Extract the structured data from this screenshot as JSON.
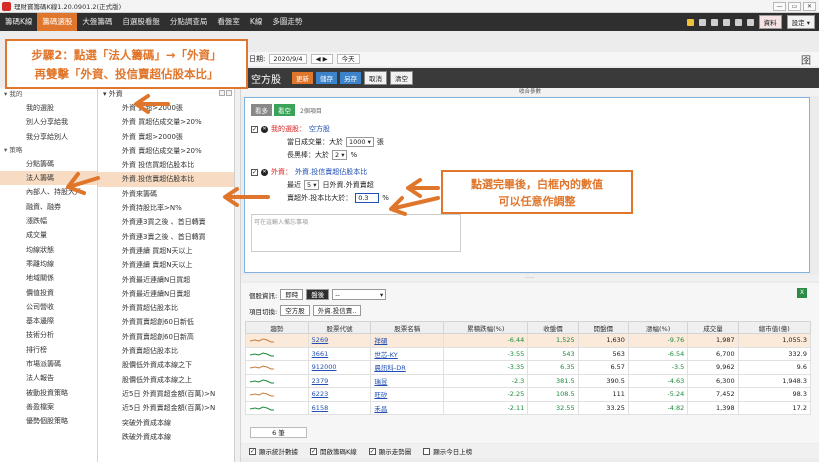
{
  "window": {
    "title": "理財寶籌碼K線1.20.0901.2(正式版)",
    "controls": [
      "—",
      "▭",
      "✕"
    ]
  },
  "menu": {
    "items": [
      "籌碼K線",
      "籌碼選股",
      "大盤籌碼",
      "自選股看盤",
      "分點調查局",
      "看盤室",
      "K線",
      "多圖走勢"
    ],
    "active_index": 1,
    "right_buttons": [
      "資料",
      "設定 ▾"
    ]
  },
  "date_bar": {
    "label": "日期:",
    "date": "2020/9/4",
    "nav": "◀ ▶",
    "today": "今天",
    "corner_icon": "囹"
  },
  "strategy_bar": {
    "name": "空方股",
    "buttons": [
      {
        "label": "更新",
        "style": "orange"
      },
      {
        "label": "儲存",
        "style": "blue"
      },
      {
        "label": "另存",
        "style": "blue"
      },
      {
        "label": "取消",
        "style": "white"
      },
      {
        "label": "清空",
        "style": "white"
      }
    ]
  },
  "collapse_label": "收合參數",
  "left_tree": {
    "group_top": "▾ 我的",
    "items_a": [
      "我的選股",
      "別人分享給我",
      "我分享給別人"
    ],
    "group_mid": "▾ 策略",
    "items_b": [
      "分點籌碼",
      "法人籌碼",
      "內部人、持股大戶",
      "融資、融券",
      "漲跌幅",
      "成交量",
      "均線狀態",
      "乖離均線",
      "地域關係",
      "價值投資",
      "公司營收",
      "基本邊際",
      "技術分析",
      "排行榜",
      "市場派籌碼",
      "法人報告",
      "被動投資策略",
      "善盈檔案",
      "優勢個股策略"
    ],
    "selected": "法人籌碼"
  },
  "mid_list": {
    "header": "▾ 外資",
    "items": [
      "外資 買超>2000張",
      "外資 買超佔成交量>20%",
      "外資 賣超>2000張",
      "外資 賣超佔成交量>20%",
      "外資 投信買超佔股本比",
      "外資.投信賣超佔股本比",
      "外資來籌碼",
      "外資持股比率>N%",
      "外資連3買之後 、首日轉賣",
      "外資連3賣之後 、首日轉買",
      "外資連續 買超N天以上",
      "外資連續 賣超N天以上",
      "外資最近連續N日買超",
      "外資最近連續N日賣超",
      "外資買超佔股本比",
      "外資買賣超創60日新低",
      "外資買賣超創60日新高",
      "外資賣超佔股本比",
      "股價低外資成本線之下",
      "股價低外資成本線之上",
      "近5日 外資買超金額(百萬)>N",
      "近5日 外資賣超金額(百萬)>N",
      "突破外資成本線",
      "跌破外資成本線"
    ],
    "selected": "外資.投信賣超佔股本比"
  },
  "conditions": {
    "tabs": [
      "看多",
      "看空"
    ],
    "active_tab": 1,
    "count_label": "2個項目",
    "cond1": {
      "check": "✓",
      "name": "我的選股：",
      "value": "空方股",
      "row1_label": "當日成交量：大於",
      "row1_value": "1000",
      "row1_unit": "張",
      "row2_label": "長黑棒：大於",
      "row2_value": "2",
      "row2_unit": "%"
    },
    "cond2": {
      "check": "✓",
      "name": "外資：",
      "value": "外資.投信賣超佔股本比",
      "row1_label": "最近",
      "row1_value": "5",
      "row1_unit": "日外資.外資賣超",
      "row2_label": "賣超外.投本比大於：",
      "row2_value": "0.3",
      "row2_unit": "%"
    },
    "notes_placeholder": "可在這輸入備忘事項"
  },
  "results": {
    "label_info": "個股資訊:",
    "btn_live": "即時",
    "btn_close": "盤後",
    "select_value": "--",
    "label_switch": "項目切換:",
    "tag1": "空方股",
    "tag2": "外資.投信賣..",
    "excel_icon": "X",
    "columns": [
      "趨勢",
      "股票代號",
      "股票名稱",
      "累積跌幅(%)",
      "收盤價",
      "開盤價",
      "漲幅(%)",
      "成交量",
      "總市值(億)"
    ],
    "rows": [
      {
        "code": "5269",
        "name": "祥碩",
        "accum": "-6.44",
        "close": "1,525",
        "open": "1,630",
        "chg": "-9.76",
        "vol": "1,987",
        "cap": "1,055.3",
        "hl": true
      },
      {
        "code": "3661",
        "name": "世芯-KY",
        "accum": "-3.55",
        "close": "543",
        "open": "563",
        "chg": "-6.54",
        "vol": "6,700",
        "cap": "332.9",
        "hl": false
      },
      {
        "code": "912000",
        "name": "晨訊科-DR",
        "accum": "-3.35",
        "close": "6.35",
        "open": "6.57",
        "chg": "-3.5",
        "vol": "9,962",
        "cap": "9.6",
        "hl": false
      },
      {
        "code": "2379",
        "name": "瑞昱",
        "accum": "-2.3",
        "close": "381.5",
        "open": "390.5",
        "chg": "-4.63",
        "vol": "6,300",
        "cap": "1,948.3",
        "hl": false
      },
      {
        "code": "6223",
        "name": "旺矽",
        "accum": "-2.25",
        "close": "108.5",
        "open": "111",
        "chg": "-5.24",
        "vol": "7,452",
        "cap": "98.3",
        "hl": false
      },
      {
        "code": "6158",
        "name": "禾昌",
        "accum": "-2.11",
        "close": "32.55",
        "open": "33.25",
        "chg": "-4.82",
        "vol": "1,398",
        "cap": "17.2",
        "hl": false
      }
    ],
    "count": "6 筆"
  },
  "status_bar": [
    "顯示統計數據",
    "開啟籌碼K線",
    "顯示走勢圖",
    "顯示今日上榜"
  ],
  "callouts": {
    "step2_line1": "步驟2：點選「法人籌碼」→「外資」",
    "step2_line2": "再雙擊「外資、投信賣超佔股本比」",
    "note_line1": "點選完畢後，白框內的數值",
    "note_line2": "可以任意作調整"
  },
  "colors": {
    "accent": "#e0762b",
    "menubar": "#2f2f2f",
    "highlight": "#f7dcc3",
    "link": "#1f4fb3",
    "negative": "#1d8a3b"
  }
}
